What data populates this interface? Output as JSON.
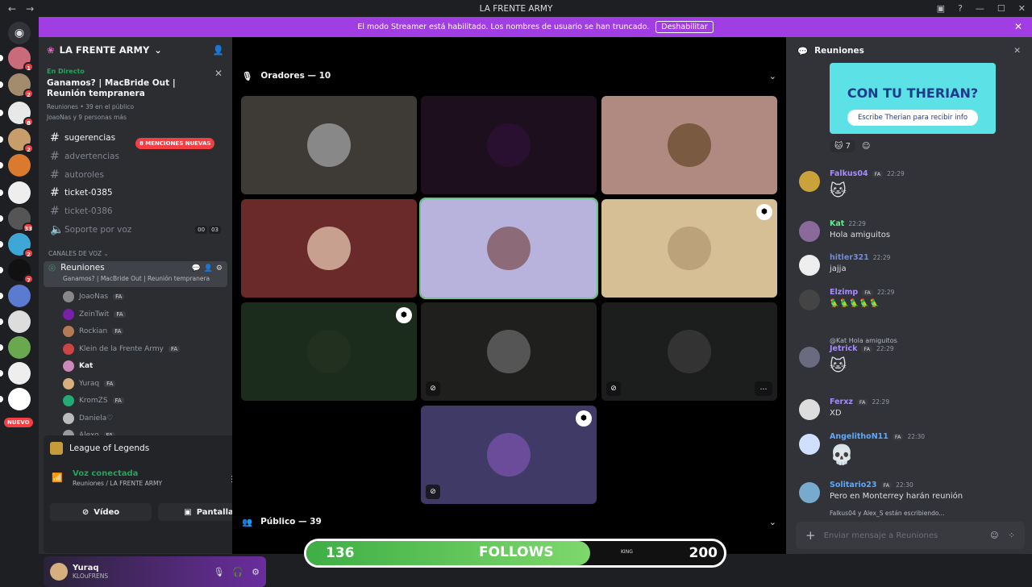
{
  "window": {
    "title": "LA FRENTE ARMY"
  },
  "streamer": {
    "text": "El modo Streamer está habilitado. Los nombres de usuario se han truncado.",
    "button": "Deshabilitar"
  },
  "guilds": [
    {
      "badge": "1"
    },
    {
      "badge": "2"
    },
    {
      "badge": "8"
    },
    {
      "badge": "2"
    },
    {
      "badge": ""
    },
    {
      "badge": ""
    },
    {
      "badge": "33"
    },
    {
      "badge": "2"
    },
    {
      "badge": "7"
    },
    {
      "badge": ""
    },
    {
      "badge": ""
    },
    {
      "badge": ""
    },
    {
      "badge": ""
    },
    {
      "badge": ""
    }
  ],
  "new_label": "NUEVO",
  "server": {
    "name": "LA FRENTE ARMY"
  },
  "event": {
    "live": "En Directo",
    "title": "Ganamos? | MacBride Out | Reunión tempranera",
    "meta": "Reuniones • 39 en el público",
    "meta2": "JoaoNas y 9 personas más"
  },
  "channels": [
    {
      "name": "sugerencias",
      "bold": true
    },
    {
      "name": "advertencias",
      "bold": false
    },
    {
      "name": "autoroles",
      "bold": false
    },
    {
      "name": "ticket-0385",
      "bold": true
    },
    {
      "name": "ticket-0386",
      "bold": false
    },
    {
      "name": "Soporte por voz",
      "bold": false,
      "count_a": "00",
      "count_b": "03"
    }
  ],
  "mentions": "8 MENCIONES NUEVAS",
  "voice_category": "CANALES DE VOZ",
  "voice_channel": {
    "name": "Reuniones",
    "topic": "Ganamos? | MacBride Out | Reunión tempranera"
  },
  "voice_users": [
    {
      "name": "JoaoNas",
      "tag": "FA"
    },
    {
      "name": "ZeinTwit",
      "tag": "FA"
    },
    {
      "name": "Rockian",
      "tag": "FA"
    },
    {
      "name": "Klein de la Frente Army",
      "tag": "FA"
    },
    {
      "name": "Kat",
      "tag": ""
    },
    {
      "name": "Yuraq",
      "tag": "FA"
    },
    {
      "name": "KromZS",
      "tag": "FA"
    },
    {
      "name": "Daniela♡",
      "tag": ""
    },
    {
      "name": "Alexo",
      "tag": "FA"
    }
  ],
  "activity": {
    "game": "League of Legends"
  },
  "voice_status": {
    "status": "Voz conectada",
    "location": "Reuniones / LA FRENTE ARMY"
  },
  "voice_buttons": {
    "video": "Vídeo",
    "screen": "Pantalla"
  },
  "user": {
    "name": "Yuraq",
    "status": "KLOuFRENS"
  },
  "stage": {
    "speakers": "Oradores — 10",
    "audience": "Público — 39"
  },
  "follows": {
    "current": "136",
    "label": "FOLLOWS",
    "goal": "200",
    "progress": 0.68,
    "king": "KING"
  },
  "chat": {
    "channel": "Reuniones",
    "promo_title": "CON TU THERIAN?",
    "promo_sub": "Escribe Therian para recibir info",
    "reaction_count": "7",
    "messages": [
      {
        "author": "Falkus04",
        "tag": "FA",
        "time": "22:29",
        "text": "",
        "color": "#a78bfa"
      },
      {
        "author": "Kat",
        "tag": "",
        "time": "22:29",
        "text": "Hola amiguitos",
        "color": "#57f287"
      },
      {
        "author": "hitler321",
        "tag": "",
        "time": "22:29",
        "text": "jajja",
        "color": "#7289da"
      },
      {
        "author": "Elzimp",
        "tag": "FA",
        "time": "22:29",
        "text": "🦜🦜🦜🦜🦜",
        "color": "#a78bfa"
      },
      {
        "author": "Jetrick",
        "tag": "FA",
        "time": "22:29",
        "text": "",
        "color": "#a78bfa",
        "reply": "@Kat Hola amiguitos"
      },
      {
        "author": "Ferxz",
        "tag": "FA",
        "time": "22:29",
        "text": "XD",
        "color": "#a78bfa"
      },
      {
        "author": "AngelithoN11",
        "tag": "FA",
        "time": "22:30",
        "text": "💀",
        "color": "#5da8ff"
      },
      {
        "author": "Solitario23",
        "tag": "FA",
        "time": "22:30",
        "text": "Pero en Monterrey harán reunión",
        "color": "#5da8ff"
      }
    ],
    "typing": "Falkus04 y Alex_S están escribiendo...",
    "input_placeholder": "Enviar mensaje a Reuniones"
  }
}
